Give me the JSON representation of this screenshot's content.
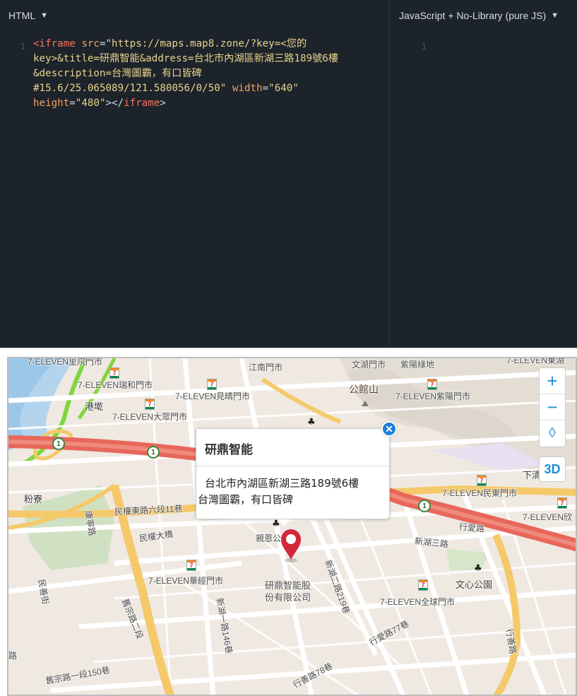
{
  "editor": {
    "html_pane": {
      "language_label": "HTML",
      "line_number": "1",
      "code_lines": [
        [
          [
            "tag",
            "<iframe"
          ],
          [
            "punct",
            " "
          ],
          [
            "attr",
            "src"
          ],
          [
            "punct",
            "="
          ],
          [
            "str",
            "\"https://maps.map8.zone/?key=<您的"
          ]
        ],
        [
          [
            "str",
            "key>&title=研鼎智能&address=台北市內湖區新湖三路189號6樓"
          ]
        ],
        [
          [
            "str",
            "&description=台灣圖霸，有口皆碑"
          ]
        ],
        [
          [
            "str",
            "#15.6/25.065089/121.580056/0/50\""
          ],
          [
            "punct",
            " "
          ],
          [
            "attr",
            "width"
          ],
          [
            "punct",
            "="
          ],
          [
            "str",
            "\"640\""
          ]
        ],
        [
          [
            "attr",
            "height"
          ],
          [
            "punct",
            "="
          ],
          [
            "str",
            "\"480\""
          ],
          [
            "punct",
            "></"
          ],
          [
            "tag",
            "iframe"
          ],
          [
            "punct",
            ">"
          ]
        ]
      ]
    },
    "js_pane": {
      "language_label": "JavaScript + No-Library (pure JS)",
      "line_number": "1"
    },
    "caret": "▼"
  },
  "map": {
    "labels": {
      "top_left_store": "7-ELEVEN里院門市",
      "jiangnan": "江南門市",
      "wenhu": "文湖門市",
      "zishi_green": "紫陽綠地",
      "top_right_store": "7-ELEVEN東湖",
      "ruihe": "7-ELEVEN瑞和門市",
      "jianqing": "7-ELEVEN見晴門市",
      "gangqi": "港墘",
      "dajing": "7-ELEVEN大眾門市",
      "gongguanshan": "公館山",
      "zizhi": "7-ELEVEN紫陽門市",
      "xiaqing": "下清",
      "mindong": "7-ELEVEN民東門市",
      "right_edge_store": "7-ELEVEN欣",
      "fenliao": "粉寮",
      "mingshan": "民權東路六段11巷",
      "minquan_bridge": "民權大橋",
      "qinen": "親恩公",
      "xinhu3": "新湖三路",
      "xingai": "行愛路",
      "huajing": "7-ELEVEN華經門市",
      "quanqiu": "7-ELEVEN全球門市",
      "wenxin_park": "文心公園",
      "company_line1": "研鼎智能股",
      "company_line2": "份有限公司",
      "road_kanglu": "康寧路",
      "road_xinhu2": "新湖二路219巷",
      "road_xinhu1": "新湖一路146巷",
      "road_xingai77": "行愛路77巷",
      "road_xingshan78": "行善路78巷",
      "road_xingshan": "行善路",
      "road_zhoumei": "舊宗路二段",
      "road_zhoumei150": "舊宗路一段150巷",
      "road_left": "民善街",
      "road_left2": "路"
    },
    "shield_number": "1",
    "popup": {
      "title": "研鼎智能",
      "address": "台北市內湖區新湖三路189號6樓",
      "description": "台灣圖霸，有口皆碑",
      "close_glyph": "✕"
    },
    "controls": {
      "zoom_in": "+",
      "zoom_out": "−",
      "compass": "◊",
      "three_d": "3D"
    },
    "colors": {
      "highway": "#e8665a",
      "arterial": "#f5c96a",
      "river": "#9cc7e8",
      "park": "#cfe1c2",
      "pin": "#d3273a",
      "accent": "#1f8fd8"
    }
  }
}
